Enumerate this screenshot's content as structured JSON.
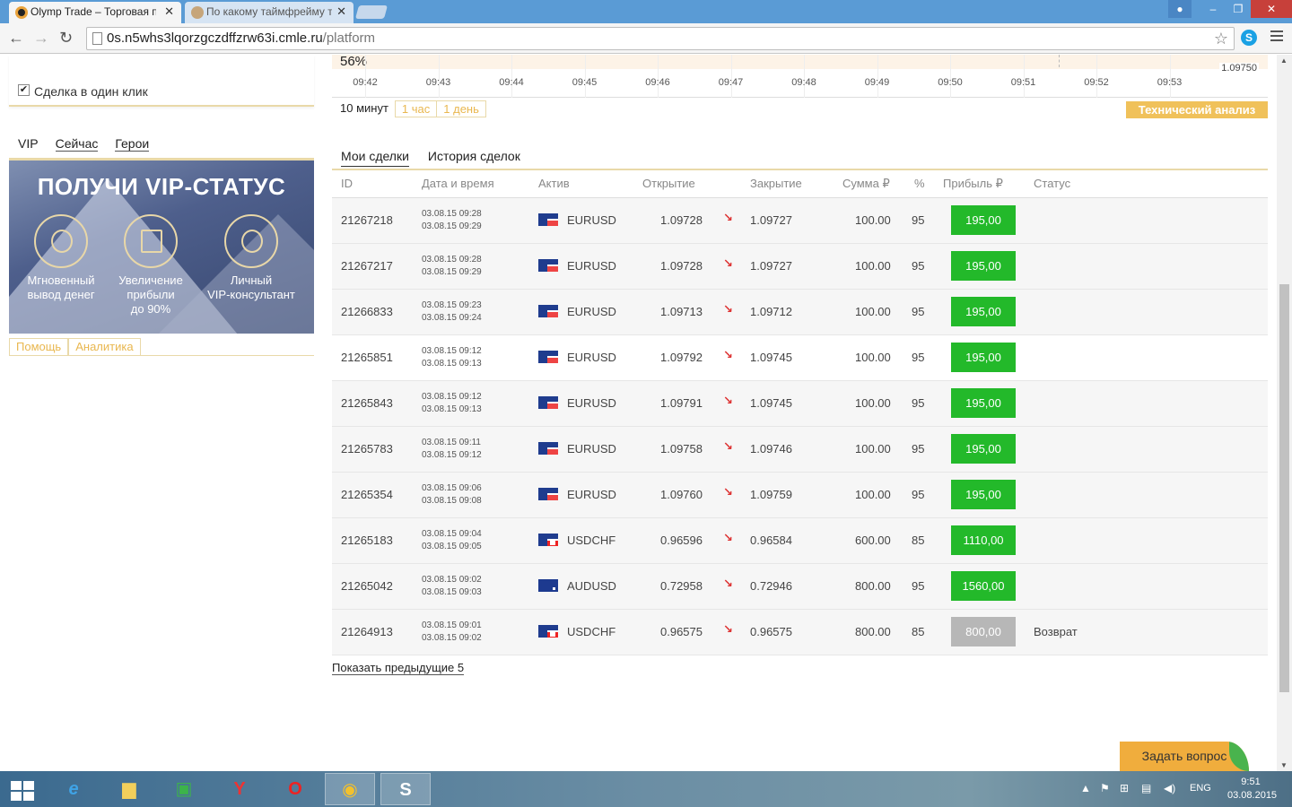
{
  "browser": {
    "tabs": [
      {
        "title": "Olymp Trade – Торговая п",
        "active": true
      },
      {
        "title": "По какому таймфрейму т",
        "active": false
      }
    ],
    "url_host": "0s.n5whs3lqorzgczdffzrw63i.cmle.ru",
    "url_path": "/platform"
  },
  "left": {
    "one_click_label": "Сделка в один клик",
    "vip_tabs": [
      "VIP",
      "Сейчас",
      "Герои"
    ],
    "vip_banner": {
      "title": "ПОЛУЧИ VIP-СТАТУС",
      "features": [
        {
          "line1": "Мгновенный",
          "line2": "вывод денег",
          "line3": ""
        },
        {
          "line1": "Увеличение",
          "line2": "прибыли",
          "line3": "до 90%"
        },
        {
          "line1": "Личный",
          "line2": "VIP-консультант",
          "line3": ""
        }
      ]
    },
    "help_tabs": [
      "Помощь",
      "Аналитика"
    ]
  },
  "chart": {
    "percent": "56%",
    "price_label": "1.09750",
    "times": [
      "09:42",
      "09:43",
      "09:44",
      "09:45",
      "09:46",
      "09:47",
      "09:48",
      "09:49",
      "09:50",
      "09:51",
      "09:52",
      "09:53"
    ],
    "timeframes": [
      "10 минут",
      "1 час",
      "1 день"
    ],
    "ta_button": "Технический анализ"
  },
  "trades": {
    "tabs": [
      "Мои сделки",
      "История сделок"
    ],
    "columns": [
      "ID",
      "Дата и время",
      "Актив",
      "Открытие",
      "Закрытие",
      "Сумма ₽",
      "%",
      "Прибыль ₽",
      "Статус"
    ],
    "rows": [
      {
        "id": "21267218",
        "open_time": "03.08.15 09:28",
        "close_time": "03.08.15 09:29",
        "flag": "eu",
        "asset": "EURUSD",
        "open": "1.09728",
        "close": "1.09727",
        "sum": "100.00",
        "pct": "95",
        "profit": "195,00",
        "status": ""
      },
      {
        "id": "21267217",
        "open_time": "03.08.15 09:28",
        "close_time": "03.08.15 09:29",
        "flag": "eu",
        "asset": "EURUSD",
        "open": "1.09728",
        "close": "1.09727",
        "sum": "100.00",
        "pct": "95",
        "profit": "195,00",
        "status": ""
      },
      {
        "id": "21266833",
        "open_time": "03.08.15 09:23",
        "close_time": "03.08.15 09:24",
        "flag": "eu",
        "asset": "EURUSD",
        "open": "1.09713",
        "close": "1.09712",
        "sum": "100.00",
        "pct": "95",
        "profit": "195,00",
        "status": ""
      },
      {
        "id": "21265851",
        "open_time": "03.08.15 09:12",
        "close_time": "03.08.15 09:13",
        "flag": "eu",
        "asset": "EURUSD",
        "open": "1.09792",
        "close": "1.09745",
        "sum": "100.00",
        "pct": "95",
        "profit": "195,00",
        "status": ""
      },
      {
        "id": "21265843",
        "open_time": "03.08.15 09:12",
        "close_time": "03.08.15 09:13",
        "flag": "eu",
        "asset": "EURUSD",
        "open": "1.09791",
        "close": "1.09745",
        "sum": "100.00",
        "pct": "95",
        "profit": "195,00",
        "status": ""
      },
      {
        "id": "21265783",
        "open_time": "03.08.15 09:11",
        "close_time": "03.08.15 09:12",
        "flag": "eu",
        "asset": "EURUSD",
        "open": "1.09758",
        "close": "1.09746",
        "sum": "100.00",
        "pct": "95",
        "profit": "195,00",
        "status": ""
      },
      {
        "id": "21265354",
        "open_time": "03.08.15 09:06",
        "close_time": "03.08.15 09:08",
        "flag": "eu",
        "asset": "EURUSD",
        "open": "1.09760",
        "close": "1.09759",
        "sum": "100.00",
        "pct": "95",
        "profit": "195,00",
        "status": ""
      },
      {
        "id": "21265183",
        "open_time": "03.08.15 09:04",
        "close_time": "03.08.15 09:05",
        "flag": "ch",
        "asset": "USDCHF",
        "open": "0.96596",
        "close": "0.96584",
        "sum": "600.00",
        "pct": "85",
        "profit": "1110,00",
        "status": ""
      },
      {
        "id": "21265042",
        "open_time": "03.08.15 09:02",
        "close_time": "03.08.15 09:03",
        "flag": "au",
        "asset": "AUDUSD",
        "open": "0.72958",
        "close": "0.72946",
        "sum": "800.00",
        "pct": "95",
        "profit": "1560,00",
        "status": ""
      },
      {
        "id": "21264913",
        "open_time": "03.08.15 09:01",
        "close_time": "03.08.15 09:02",
        "flag": "ch",
        "asset": "USDCHF",
        "open": "0.96575",
        "close": "0.96575",
        "sum": "800.00",
        "pct": "85",
        "profit": "800,00",
        "status": "Возврат"
      }
    ],
    "show_prev": "Показать предыдущие 5"
  },
  "ask_button": "Задать вопрос",
  "taskbar": {
    "lang": "ENG",
    "time": "9:51",
    "date": "03.08.2015"
  },
  "colors": {
    "profit_green": "#23b92a",
    "refund_grey": "#b7b7b7",
    "accent_gold": "#f0c15a",
    "title_bar": "#5a9bd5"
  }
}
